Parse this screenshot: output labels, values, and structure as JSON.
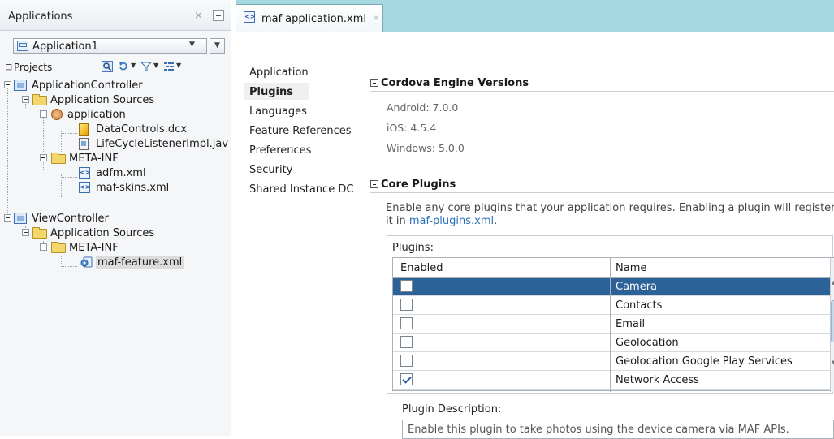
{
  "left_panel": {
    "title": "Applications",
    "close_glyph": "×",
    "application_selector": "Application1",
    "projects_label": "Projects",
    "tree": [
      {
        "label": "ApplicationController",
        "icon": "project-icon"
      },
      {
        "label": "Application Sources",
        "icon": "folder-icon"
      },
      {
        "label": "application",
        "icon": "package-icon"
      },
      {
        "label": "DataControls.dcx",
        "icon": "dcx-file-icon"
      },
      {
        "label": "LifeCycleListenerImpl.jav",
        "icon": "java-file-icon"
      },
      {
        "label": "META-INF",
        "icon": "folder-icon"
      },
      {
        "label": "adfm.xml",
        "icon": "xml-file-icon"
      },
      {
        "label": "maf-skins.xml",
        "icon": "xml-file-icon"
      },
      {
        "label": "ViewController",
        "icon": "project-icon"
      },
      {
        "label": "Application Sources",
        "icon": "folder-icon"
      },
      {
        "label": "META-INF",
        "icon": "folder-icon"
      },
      {
        "label": "maf-feature.xml",
        "icon": "maf-feature-icon"
      }
    ]
  },
  "editor": {
    "tab_label": "maf-application.xml",
    "tab_close": "×",
    "nav": [
      "Application",
      "Plugins",
      "Languages",
      "Feature References",
      "Preferences",
      "Security",
      "Shared Instance DC"
    ],
    "cordova": {
      "heading": "Cordova Engine Versions",
      "android": "Android: 7.0.0",
      "ios": "iOS: 4.5.4",
      "windows": "Windows: 5.0.0"
    },
    "core_plugins": {
      "heading": "Core Plugins",
      "description_prefix": "Enable any core plugins that your application requires. Enabling a plugin will register it in ",
      "description_link": "maf-plugins.xml",
      "description_suffix": ".",
      "plugins_caption": "Plugins:",
      "col_enabled": "Enabled",
      "col_name": "Name",
      "rows": [
        {
          "name": "Camera",
          "enabled": false,
          "selected": true
        },
        {
          "name": "Contacts",
          "enabled": false,
          "selected": false
        },
        {
          "name": "Email",
          "enabled": false,
          "selected": false
        },
        {
          "name": "Geolocation",
          "enabled": false,
          "selected": false
        },
        {
          "name": "Geolocation Google Play Services",
          "enabled": false,
          "selected": false
        },
        {
          "name": "Network Access",
          "enabled": true,
          "selected": false
        }
      ],
      "plugin_description_label": "Plugin Description:",
      "plugin_description": "Enable this plugin to take photos using the device camera via MAF APIs."
    }
  },
  "colors": {
    "tab_bar": "#a6d8e2",
    "selection": "#2d6299",
    "link": "#2c6fb8"
  }
}
